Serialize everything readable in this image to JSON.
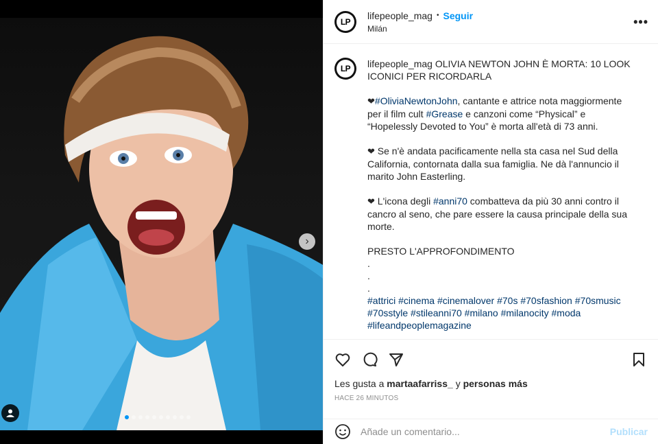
{
  "post": {
    "username": "lifepeople_mag",
    "avatar_text": "LP",
    "follow_label": "Seguir",
    "location": "Milán",
    "more_label": "•••"
  },
  "caption": {
    "username": "lifepeople_mag",
    "title": "OLIVIA NEWTON JOHN È MORTA: 10 LOOK ICONICI PER RICORDARLA",
    "p1_tag": "#OliviaNewtonJohn",
    "p1_text_a": ", cantante e attrice nota maggiormente per il film cult ",
    "p1_tag2": "#Grease",
    "p1_text_b": " e canzoni come “Physical” e “Hopelessly Devoted to You” è morta all'età di 73 anni.",
    "p2_text": "Se n'è andata pacificamente nella sta casa nel Sud della California, contornata dalla sua famiglia. Ne dà l'annuncio il marito John Easterling.",
    "p3_text_a": "L'icona degli ",
    "p3_tag": "#anni70",
    "p3_text_b": " combatteva da più 30 anni contro il cancro al seno, che pare essere la causa principale della sua morte.",
    "p4_text": "PRESTO L'APPROFONDIMENTO",
    "dots": [
      ".",
      ".",
      "."
    ],
    "hashtags": [
      "#attrici",
      "#cinema",
      "#cinemalover",
      "#70s",
      "#70sfashion",
      "#70smusic",
      "#70sstyle",
      "#stileanni70",
      "#milano",
      "#milanocity",
      "#moda",
      "#lifeandpeoplemagazine"
    ],
    "heart": "❤"
  },
  "likes": {
    "prefix": "Les gusta a",
    "user": "martaafarriss_",
    "middle": "y",
    "others": "personas más"
  },
  "timestamp": "HACE 26 MINUTOS",
  "comment": {
    "placeholder": "Añade un comentario...",
    "publish_label": "Publicar"
  },
  "carousel": {
    "total": 10,
    "active_index": 0
  },
  "colors": {
    "accent": "#0095f6",
    "hashtag": "#00376b",
    "publish_disabled": "#b2dffc"
  }
}
